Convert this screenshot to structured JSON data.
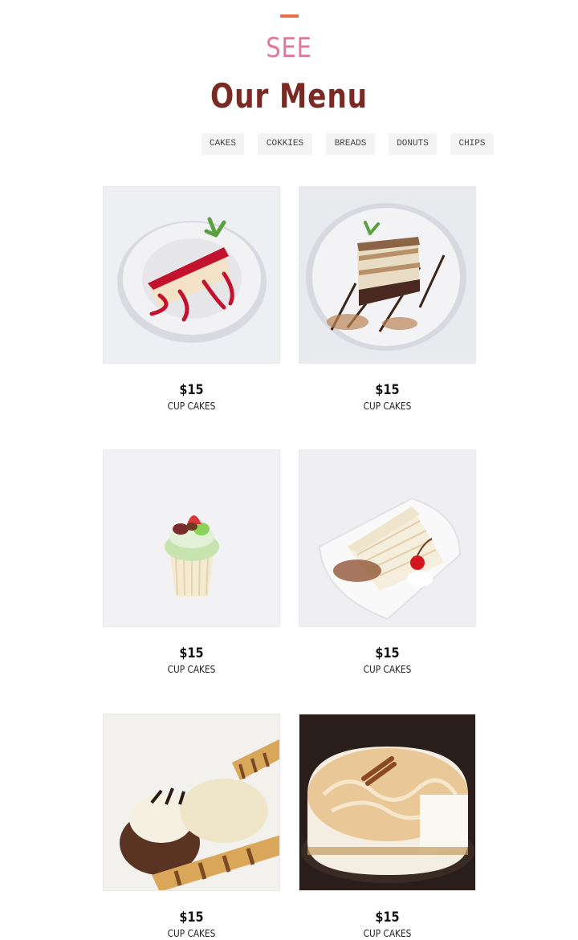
{
  "header": {
    "eyebrow": "SEE",
    "title": "Our Menu",
    "accent_color": "#ee6c45",
    "eyebrow_color": "#e07898",
    "title_color": "#7a2a22"
  },
  "tabs": [
    {
      "label": "CAKES"
    },
    {
      "label": "COKKIES"
    },
    {
      "label": "BREADS"
    },
    {
      "label": "DONUTS"
    },
    {
      "label": "CHIPS"
    }
  ],
  "menu": {
    "items": [
      {
        "price": "$15",
        "name": "CUP CAKES",
        "image": "strawberry-cheesecake-slice"
      },
      {
        "price": "$15",
        "name": "CUP CAKES",
        "image": "tiramisu-slice"
      },
      {
        "price": "$15",
        "name": "CUP CAKES",
        "image": "cupcake-with-fruit"
      },
      {
        "price": "$15",
        "name": "CUP CAKES",
        "image": "crepe-cake-with-cherry"
      },
      {
        "price": "$15",
        "name": "CUP CAKES",
        "image": "dessert-plate-with-wafer-rolls"
      },
      {
        "price": "$15",
        "name": "CUP CAKES",
        "image": "cinnamon-cheesecake"
      }
    ]
  }
}
